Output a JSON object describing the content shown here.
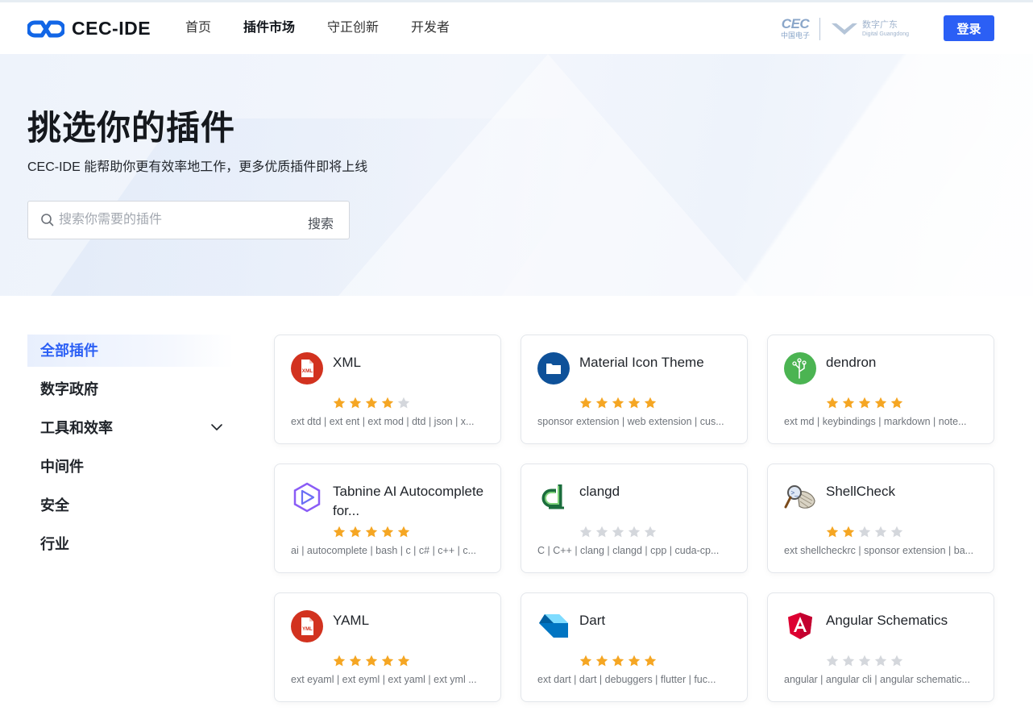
{
  "header": {
    "logo_text": "CEC-IDE",
    "nav": [
      "首页",
      "插件市场",
      "守正创新",
      "开发者"
    ],
    "active_nav": 1,
    "partner_cec": "CEC",
    "partner_cec_sub": "中国电子",
    "partner_gd": "数字广东",
    "partner_gd_en": "Digital Guangdong",
    "login": "登录"
  },
  "hero": {
    "title": "挑选你的插件",
    "subtitle": "CEC-IDE 能帮助你更有效率地工作，更多优质插件即将上线",
    "search_placeholder": "搜索你需要的插件",
    "search_button": "搜索"
  },
  "sidebar": {
    "items": [
      {
        "label": "全部插件",
        "active": true
      },
      {
        "label": "数字政府"
      },
      {
        "label": "工具和效率",
        "expandable": true
      },
      {
        "label": "中间件"
      },
      {
        "label": "安全"
      },
      {
        "label": "行业"
      }
    ]
  },
  "colors": {
    "accent": "#2b5ff5",
    "star_on": "#f5a623",
    "star_off": "#d4d7dc"
  },
  "plugins": [
    {
      "name": "XML",
      "icon": "xml-file-icon",
      "rating": 4,
      "tags": "ext dtd | ext ent | ext mod | dtd | json | x..."
    },
    {
      "name": "Material Icon Theme",
      "icon": "folder-icon",
      "rating": 5,
      "tags": "sponsor extension | web extension | cus..."
    },
    {
      "name": "dendron",
      "icon": "dendron-tree-icon",
      "rating": 5,
      "tags": "ext md | keybindings | markdown | note..."
    },
    {
      "name": "Tabnine AI Autocomplete for...",
      "icon": "tabnine-hexagon-icon",
      "rating": 5,
      "tags": "ai | autocomplete | bash | c | c# | c++ | c..."
    },
    {
      "name": "clangd",
      "icon": "clangd-icon",
      "rating": 0,
      "tags": "C | C++ | clang | clangd | cpp | cuda-cp..."
    },
    {
      "name": "ShellCheck",
      "icon": "shellcheck-icon",
      "rating": 2,
      "tags": "ext shellcheckrc | sponsor extension | ba..."
    },
    {
      "name": "YAML",
      "icon": "yaml-file-icon",
      "rating": 5,
      "tags": "ext eyaml | ext eyml | ext yaml | ext yml ..."
    },
    {
      "name": "Dart",
      "icon": "dart-icon",
      "rating": 5,
      "tags": "ext dart | dart | debuggers | flutter | fuc..."
    },
    {
      "name": "Angular Schematics",
      "icon": "angular-icon",
      "rating": 0,
      "tags": "angular | angular cli | angular schematic..."
    }
  ]
}
